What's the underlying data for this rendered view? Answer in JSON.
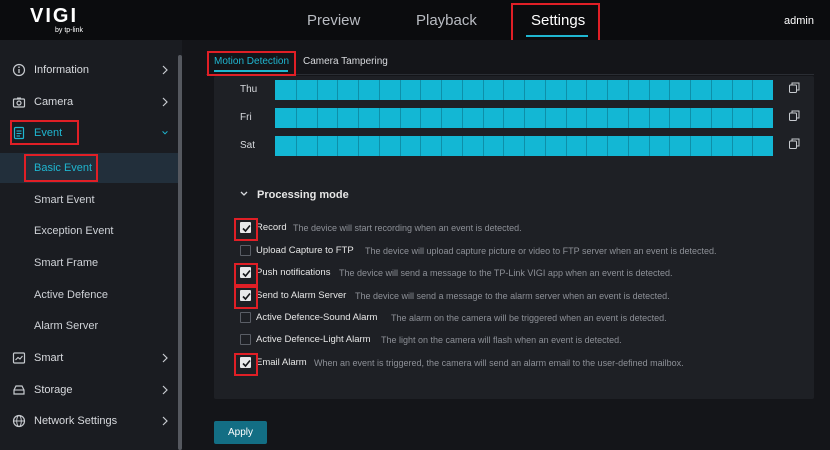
{
  "brand": {
    "name": "VIGI",
    "sub": "by tp-link"
  },
  "nav": {
    "preview": "Preview",
    "playback": "Playback",
    "settings": "Settings",
    "user": "admin"
  },
  "sidebar": {
    "items": [
      {
        "label": "Information",
        "icon": "info-icon"
      },
      {
        "label": "Camera",
        "icon": "camera-icon"
      },
      {
        "label": "Event",
        "icon": "event-icon"
      },
      {
        "label": "Smart",
        "icon": "smart-icon"
      },
      {
        "label": "Storage",
        "icon": "storage-icon"
      },
      {
        "label": "Network Settings",
        "icon": "globe-icon"
      }
    ],
    "event_sub": [
      "Basic Event",
      "Smart Event",
      "Exception Event",
      "Smart Frame",
      "Active Defence",
      "Alarm Server"
    ]
  },
  "tabs": {
    "motion": "Motion Detection",
    "tampering": "Camera Tampering"
  },
  "schedule": {
    "days": [
      "Thu",
      "Fri",
      "Sat"
    ],
    "segments": 24,
    "fill_color": "#13b7d4"
  },
  "processing": {
    "title": "Processing mode",
    "options": [
      {
        "name": "Record",
        "desc": "The device will start recording when an event is detected.",
        "checked": true
      },
      {
        "name": "Upload Capture to FTP",
        "desc": "The device will upload capture picture or video to FTP server when an event is detected.",
        "checked": false
      },
      {
        "name": "Push notifications",
        "desc": "The device will send a message to the TP-Link VIGI app when an event is detected.",
        "checked": true
      },
      {
        "name": "Send to Alarm Server",
        "desc": "The device will send a message to the alarm server when an event is detected.",
        "checked": true
      },
      {
        "name": "Active Defence-Sound Alarm",
        "desc": "The alarm on the camera will be triggered when an event is detected.",
        "checked": false
      },
      {
        "name": "Active Defence-Light Alarm",
        "desc": "The light on the camera will flash when an event is detected.",
        "checked": false
      },
      {
        "name": "Email Alarm",
        "desc": "When an event is triggered, the camera will send an alarm email to the user-defined mailbox.",
        "checked": true
      }
    ]
  },
  "apply_label": "Apply",
  "colors": {
    "accent": "#1fb6d0",
    "highlight": "#e01f26",
    "button": "#136e84"
  }
}
